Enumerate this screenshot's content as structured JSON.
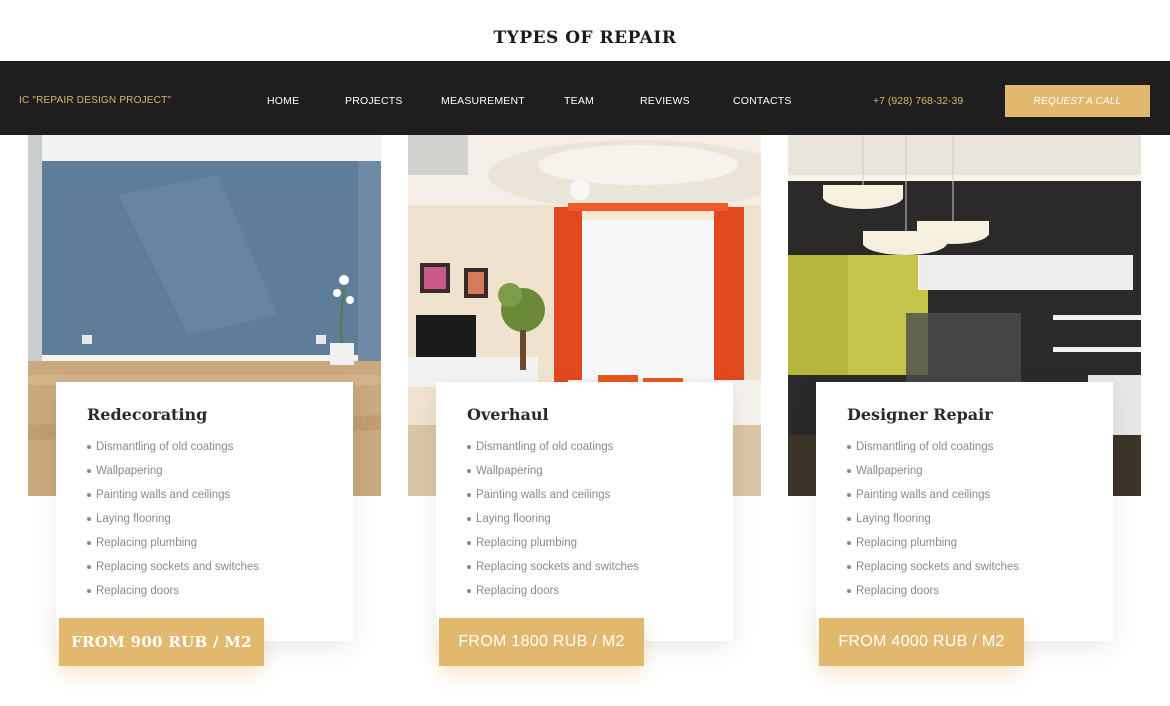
{
  "section": {
    "title": "TYPES OF REPAIR"
  },
  "navbar": {
    "brand": "IC \"REPAIR DESIGN PROJECT\"",
    "links": [
      "HOME",
      "PROJECTS",
      "MEASUREMENT",
      "TEAM",
      "REVIEWS",
      "CONTACTS"
    ],
    "phone": "+7 (928) 768-32-39",
    "cta_label": "REQUEST A CALL"
  },
  "colors": {
    "accent": "#e2b86e",
    "nav_bg": "#1e1e1e",
    "brand_text": "#d8b56c"
  },
  "cards": [
    {
      "title": "Redecorating",
      "image": "room-blue-wall-image",
      "features": [
        "Dismantling of old coatings",
        "Wallpapering",
        "Painting walls and ceilings",
        "Laying flooring",
        "Replacing plumbing",
        "Replacing sockets and switches",
        "Replacing doors"
      ],
      "price": "FROM 900 RUB / M2"
    },
    {
      "title": "Overhaul",
      "image": "living-room-orange-curtains-image",
      "features": [
        "Dismantling of old coatings",
        "Wallpapering",
        "Painting walls and ceilings",
        "Laying flooring",
        "Replacing plumbing",
        "Replacing sockets and switches",
        "Replacing doors"
      ],
      "price": "FROM 1800 RUB / M2"
    },
    {
      "title": "Designer Repair",
      "image": "modern-kitchen-pendant-lamps-image",
      "features": [
        "Dismantling of old coatings",
        "Wallpapering",
        "Painting walls and ceilings",
        "Laying flooring",
        "Replacing plumbing",
        "Replacing sockets and switches",
        "Replacing doors"
      ],
      "price": "FROM 4000 RUB / M2"
    }
  ]
}
